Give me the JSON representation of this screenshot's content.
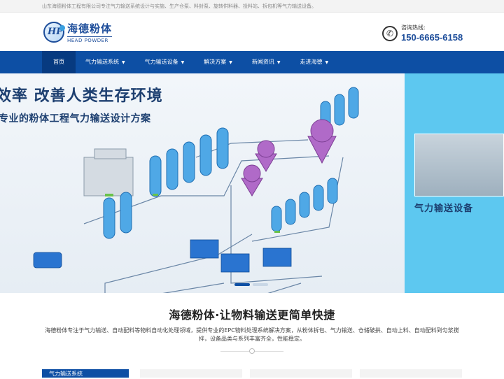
{
  "topbar": {
    "text": "山东海德粉体工程有限公司专注气力输送系统设计与实施、生产仓泵、料封泵、旋转供料器、投料站、拆包机等气力输送设备。"
  },
  "logo": {
    "mark": "HP",
    "name_cn": "海德粉体",
    "name_en": "HEAD POWDER"
  },
  "hotline": {
    "label": "咨询热线:",
    "number": "150-6665-6158"
  },
  "nav": {
    "items": [
      {
        "label": "首页"
      },
      {
        "label": "气力输送系统"
      },
      {
        "label": "气力输送设备"
      },
      {
        "label": "解决方案"
      },
      {
        "label": "新闻资讯"
      },
      {
        "label": "走进海德"
      }
    ]
  },
  "banner": {
    "slogan_main": "效率 改善人类生存环境",
    "slogan_sub": "专业的粉体工程气力输送设计方案",
    "side_caption": "气力输送设备"
  },
  "intro": {
    "title": "海德粉体·让物料输送更简单快捷",
    "desc": "海德粉体专注于气力输送、自动配料等物料自动化处理领域，提供专业的EPC物料处理系统解决方案，从粉体拆包、气力输送、仓储破拱、自动上料、自动配料到匀浆搅拌，设备品类与系列丰富齐全，性能稳定。"
  },
  "bottom": {
    "tab_label": "气力输送系统"
  },
  "colors": {
    "brand": "#0d4fa4",
    "nav_active": "#073a80",
    "accent_blue": "#5dc8f0"
  }
}
